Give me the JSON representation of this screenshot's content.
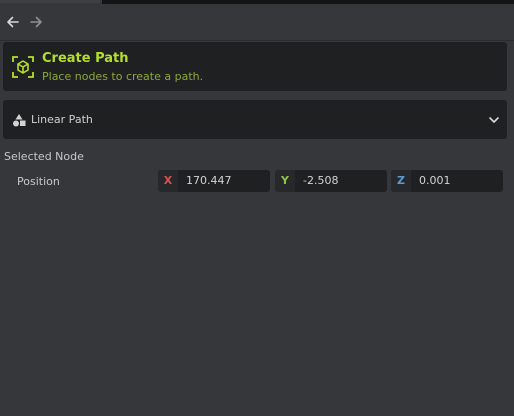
{
  "nav": {
    "back_icon": "arrow-left-icon",
    "forward_icon": "arrow-right-icon"
  },
  "create_path": {
    "icon": "cube-icon",
    "title": "Create Path",
    "subtitle": "Place nodes to create a path."
  },
  "path_type": {
    "icon": "shapes-icon",
    "selected": "Linear Path",
    "chevron_icon": "chevron-down-icon"
  },
  "selected_node": {
    "section_label": "Selected Node",
    "position_label": "Position",
    "x": {
      "axis": "X",
      "value": "170.447",
      "color": "#d9534f"
    },
    "y": {
      "axis": "Y",
      "value": "-2.508",
      "color": "#8cc63f"
    },
    "z": {
      "axis": "Z",
      "value": "0.001",
      "color": "#5b9bd5"
    }
  },
  "colors": {
    "accent": "#b5df2c",
    "panel_bg": "#36373b",
    "card_bg": "#1f2022"
  }
}
